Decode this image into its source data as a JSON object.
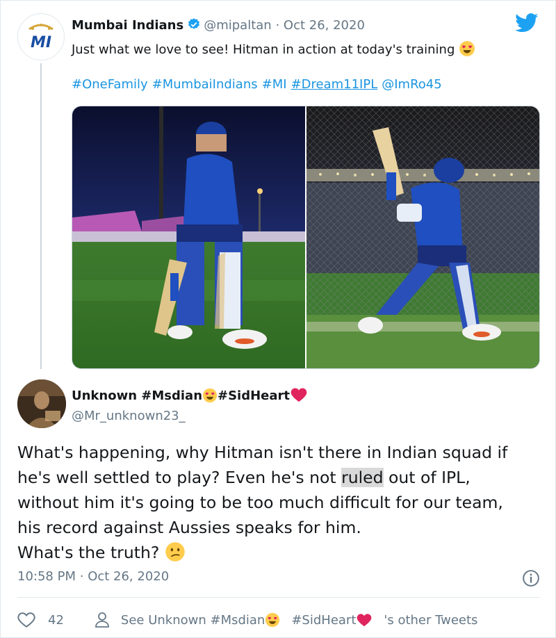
{
  "colors": {
    "brand_blue": "#1da1f2",
    "link_blue": "#1b95e0",
    "muted": "#657786",
    "text": "#14171a",
    "heart": "#e0245e",
    "mi_blue": "#1a4fa3",
    "mi_gold": "#d6a63a"
  },
  "parent_tweet": {
    "author_name": "Mumbai Indians",
    "verified_icon": "verified-badge-icon",
    "handle": "@mipaltan",
    "separator": "·",
    "date": "Oct 26, 2020",
    "text": "Just what we love to see! Hitman in action at today's training",
    "emoji": "heart-eyes-emoji",
    "hashtags": [
      "#OneFamily",
      "#MumbaiIndians",
      "#MI",
      "#Dream11IPL",
      "@ImRo45"
    ],
    "avatar_logo": "MI",
    "logo_icon": "twitter-bird-icon",
    "media": [
      "batsman-walking-photo",
      "batsman-batting-nets-photo"
    ]
  },
  "reply": {
    "author_name_part1": "Unknown #Msdian",
    "author_name_part2": "#SidHeart",
    "handle": "@Mr_unknown23_",
    "body_line1": "What's happening, why Hitman isn't there in Indian squad if",
    "body_line2_a": "he's well settled to play? Even he's not ",
    "body_line2_hl": "ruled",
    "body_line2_b": " out of IPL,",
    "body_line3": "without him it's going to be too much difficult for our team,",
    "body_line4": "his record against Aussies speaks for him.",
    "body_line5": "What's the truth?",
    "time": "10:58 PM",
    "separator": "·",
    "date": "Oct 26, 2020",
    "info_icon": "info-icon"
  },
  "actions": {
    "like_count": "42",
    "see_prefix": "See Unknown #Msdian",
    "see_mid": "#SidHeart",
    "see_suffix": "'s other Tweets"
  }
}
